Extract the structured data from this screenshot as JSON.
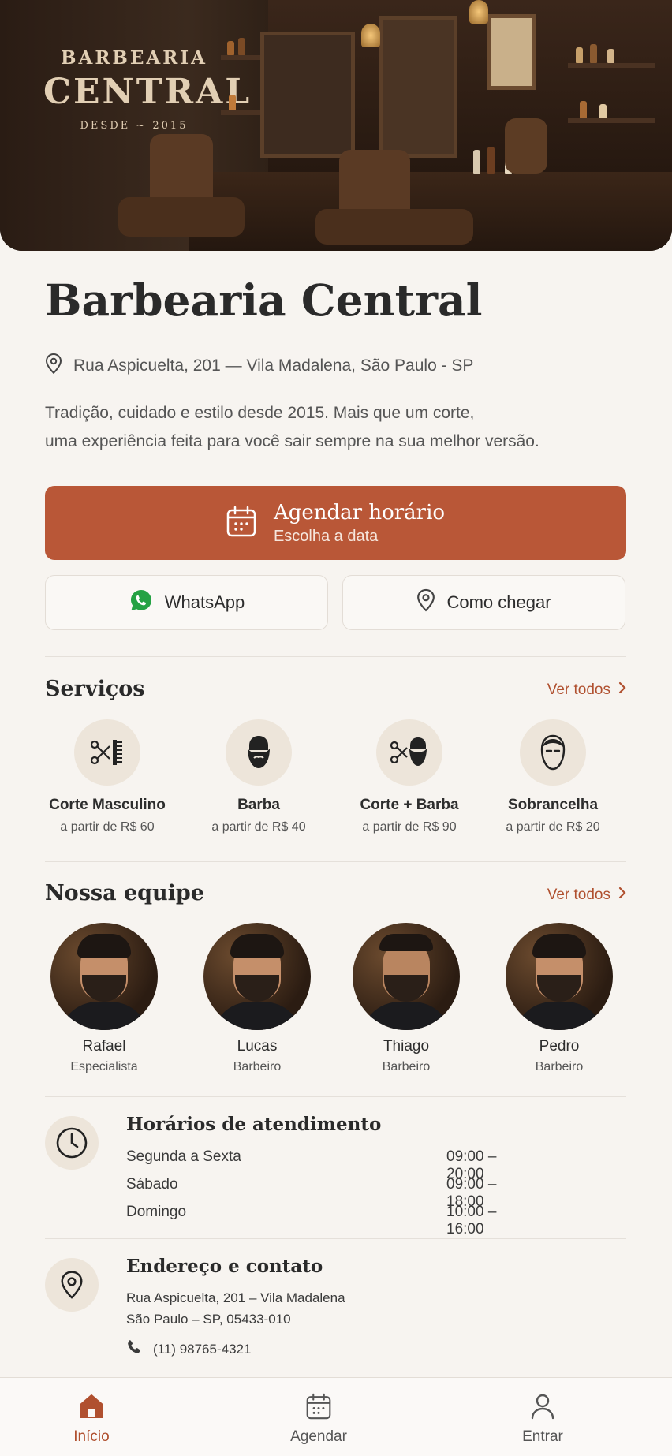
{
  "hero": {
    "sign_line1": "BARBEARIA",
    "sign_line2": "CENTRAL",
    "sign_line3": "DESDE ~ 2015"
  },
  "shop": {
    "name": "Barbearia Central",
    "address": "Rua Aspicuelta, 201 — Vila Madalena, São Paulo - SP",
    "description_line1": "Tradição, cuidado e estilo desde 2015. Mais que um corte,",
    "description_line2": "uma experiência feita para você sair sempre na sua melhor versão."
  },
  "actions": {
    "book_title": "Agendar horário",
    "book_subtitle": "Escolha a data",
    "whatsapp": "WhatsApp",
    "directions": "Como chegar"
  },
  "services": {
    "title": "Serviços",
    "see_all": "Ver todos",
    "items": [
      {
        "name": "Corte Masculino",
        "price": "a partir de R$ 60",
        "icon": "scissors-comb-icon"
      },
      {
        "name": "Barba",
        "price": "a partir de R$ 40",
        "icon": "beard-icon"
      },
      {
        "name": "Corte + Barba",
        "price": "a partir de R$ 90",
        "icon": "scissors-beard-icon"
      },
      {
        "name": "Sobrancelha",
        "price": "a partir de R$ 20",
        "icon": "face-icon"
      }
    ]
  },
  "team": {
    "title": "Nossa equipe",
    "see_all": "Ver todos",
    "members": [
      {
        "name": "Rafael",
        "role": "Especialista"
      },
      {
        "name": "Lucas",
        "role": "Barbeiro"
      },
      {
        "name": "Thiago",
        "role": "Barbeiro"
      },
      {
        "name": "Pedro",
        "role": "Barbeiro"
      }
    ]
  },
  "hours": {
    "title": "Horários de atendimento",
    "rows": [
      {
        "day": "Segunda a Sexta",
        "time": "09:00 – 20:00"
      },
      {
        "day": "Sábado",
        "time": "09:00 – 18:00"
      },
      {
        "day": "Domingo",
        "time": "10:00 – 16:00"
      }
    ]
  },
  "contact": {
    "title": "Endereço e contato",
    "line1": "Rua Aspicuelta, 201 – Vila Madalena",
    "line2": "São Paulo – SP, 05433-010",
    "phone": "(11) 98765-4321"
  },
  "nav": {
    "home": "Início",
    "book": "Agendar",
    "login": "Entrar"
  },
  "colors": {
    "accent": "#b95737",
    "link": "#b0502f",
    "whatsapp": "#25a244",
    "background": "#f7f4f0"
  }
}
